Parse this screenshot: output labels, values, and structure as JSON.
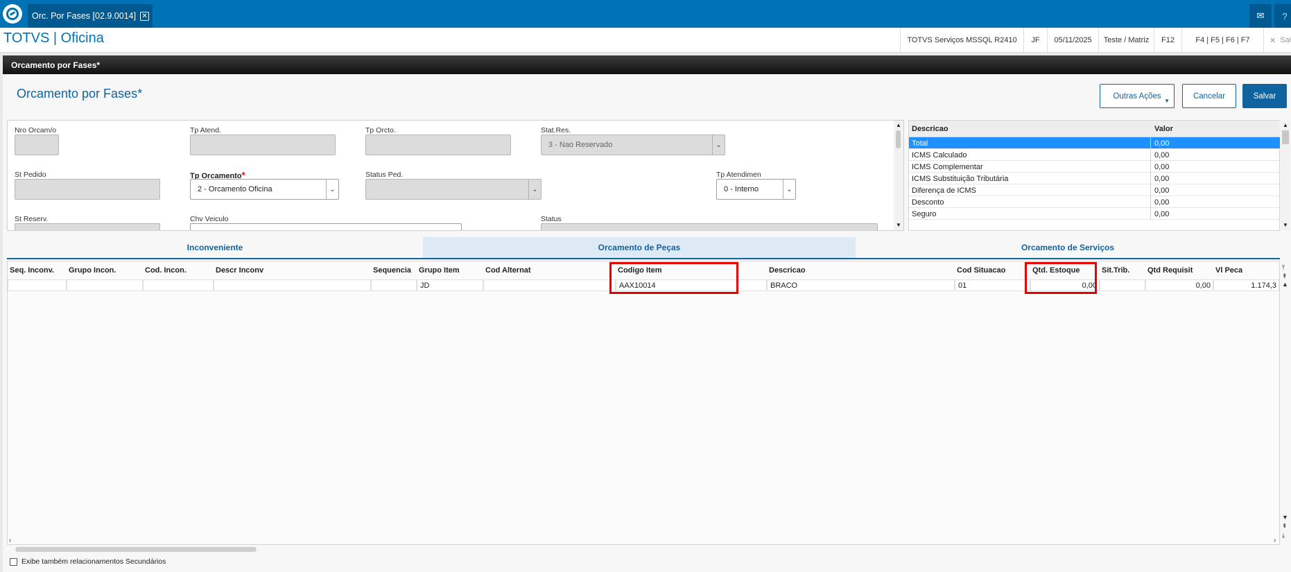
{
  "tabbar": {
    "app_tab_label": "Orc. Por Fases [02.9.0014]",
    "mail_icon": "mail-icon",
    "help_icon": "help-icon"
  },
  "system": {
    "app_title": "TOTVS | Oficina",
    "environment": "TOTVS Serviços MSSQL R2410",
    "user": "JF",
    "date": "05/11/2025",
    "branch": "Teste / Matriz",
    "shortcut_f12": "F12",
    "shortcuts": "F4 | F5 | F6 | F7",
    "exit_label": "Sair"
  },
  "window": {
    "title": "Orcamento por Fases*",
    "page_title": "Orcamento por Fases*"
  },
  "actions": {
    "other": "Outras Ações",
    "cancel": "Cancelar",
    "save": "Salvar"
  },
  "form": {
    "nro_orcamo_label": "Nro Orcam/o",
    "nro_orcamo_value": "",
    "tp_atend_label": "Tp Atend.",
    "tp_orcto_label": "Tp Orcto.",
    "stat_res_label": "Stat.Res.",
    "stat_res_value": "3 - Nao Reservado",
    "st_pedido_label": "St Pedido",
    "tp_orcamento_label": "Tp Orcamento",
    "tp_orcamento_required": "*",
    "tp_orcamento_value": "2 - Orcamento Oficina",
    "status_ped_label": "Status Ped.",
    "status_ped_value": "",
    "tp_atendimen_label": "Tp Atendimen",
    "tp_atendimen_value": "0 - Interno",
    "st_reserv_label": "St Reserv.",
    "chv_veiculo_label": "Chv Veiculo",
    "status_label": "Status"
  },
  "totals": {
    "col_descricao": "Descricao",
    "col_valor": "Valor",
    "rows": [
      {
        "descricao": "Total",
        "valor": "0,00"
      },
      {
        "descricao": "ICMS Calculado",
        "valor": "0,00"
      },
      {
        "descricao": "ICMS Complementar",
        "valor": "0,00"
      },
      {
        "descricao": "ICMS Substituição Tributária",
        "valor": "0,00"
      },
      {
        "descricao": "Diferença de ICMS",
        "valor": "0,00"
      },
      {
        "descricao": "Desconto",
        "valor": "0,00"
      },
      {
        "descricao": "Seguro",
        "valor": "0,00"
      }
    ],
    "selected_index": 0
  },
  "tabs": [
    {
      "label": "Inconveniente",
      "active": false
    },
    {
      "label": "Orcamento de Peças",
      "active": true
    },
    {
      "label": "Orcamento de Serviços",
      "active": false
    }
  ],
  "grid": {
    "columns": [
      "Seq. Inconv.",
      "Grupo Incon.",
      "Cod. Incon.",
      "Descr Inconv",
      "Sequencia",
      "Grupo Item",
      "Cod Alternat",
      "Codigo Item",
      "Descricao",
      "Cod Situacao",
      "Qtd. Estoque",
      "Sit.Trib.",
      "Qtd Requisit",
      "Vl Peca"
    ],
    "rows": [
      [
        "",
        "",
        "",
        "",
        "",
        "JD",
        "",
        "AAX10014",
        "BRACO",
        "01",
        "0,00",
        "",
        "0,00",
        "1.174,3"
      ]
    ]
  },
  "footer": {
    "secondary_label": "Exibe também relacionamentos Secundários"
  }
}
